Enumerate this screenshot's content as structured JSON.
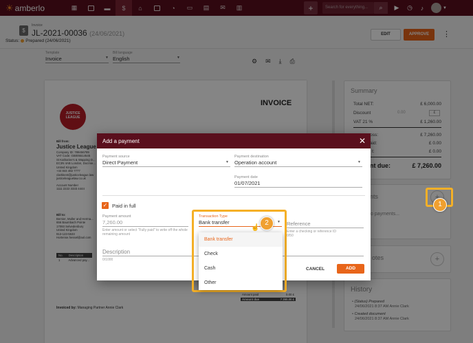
{
  "app": {
    "name": "amberlo"
  },
  "topbar": {
    "nav_icons": [
      "grid-icon",
      "contacts-icon",
      "briefcase-icon",
      "invoice-icon",
      "bank-icon",
      "calendar-icon",
      "phone-icon",
      "folder-icon",
      "documents-icon",
      "mail-icon",
      "reports-icon"
    ],
    "active_icon": "invoice-icon",
    "plus_label": "+",
    "search_placeholder": "Search for everything..."
  },
  "header": {
    "type_label": "Invoice",
    "number": "JL-2021-00036",
    "number_date": "(24/06/2021)",
    "status_prefix": "Status:",
    "status_text": "Prepared (24/06/2021)",
    "edit_label": "EDIT",
    "approve_label": "APPROVE"
  },
  "toolbar": {
    "template_label": "Template",
    "template_value": "Invoice",
    "language_label": "Bill language",
    "language_value": "English"
  },
  "paper": {
    "title": "INVOICE",
    "seal_text": "JUSTICE LEAGUE",
    "bill_from_label": "Bill from:",
    "company": "Justice League Law",
    "company_lines": [
      "Company ID: 789456789",
      "VAT Code: GB005514545",
      "St Katharine's & Wapping D...",
      "EC3N 4AB London, Docmie...",
      "United Kingdom",
      "+44 844 482 7777",
      "clarkkent@justiceleague.law",
      "justiceleaguelaw.co.uk"
    ],
    "account_label": "Account Number",
    "account_number": "1111 2222 3333 4444",
    "bill_to_label": "Bill to:",
    "bill_to_lines": [
      "Bernier, Muller and Herma...",
      "656 Baumbach Pointe",
      "17093 Selvedenbury",
      "United Kingdom",
      "913-123-5533",
      "Hortense.hessel@aol.com"
    ],
    "table_headers": [
      "No.",
      "Description"
    ],
    "table_row": [
      "1",
      "Advanced pay..."
    ],
    "amount_paid_label": "Amount paid",
    "amount_paid_value": "0.00 £",
    "amount_due_label": "Amount due",
    "amount_due_value": "7 260.00 £",
    "invoiced_by_label": "Invoiced by:",
    "invoiced_by_value": "Managing Partner Annie Clark"
  },
  "summary": {
    "title": "Summary",
    "total_net_label": "Total NET:",
    "total_net_value": "£ 6,000.00",
    "discount_label": "Discount",
    "discount_input": "0.00",
    "discount_currency": "£",
    "vat_label": "VAT 21 %",
    "vat_value": "£ 1,260.00",
    "gross_label": "ross:",
    "gross_value": "£ 7,260.00",
    "paid_label": "aid:",
    "paid_value": "£ 0.00",
    "credit_label": "t:",
    "credit_value": "£ 0.00",
    "due_label": "nt due:",
    "due_value": "£ 7,260.00"
  },
  "payments": {
    "title": "nts",
    "empty": "o payments..."
  },
  "notes": {
    "title": "otes"
  },
  "history": {
    "title": "History",
    "entries": [
      {
        "action": "(Status) Prepared",
        "meta": "24/06/2021 8:37 AM Annie Clark"
      },
      {
        "action": "Created document",
        "meta": "24/06/2021 8:37 AM Annie Clark"
      }
    ]
  },
  "modal": {
    "title": "Add a payment",
    "source_label": "Payment source",
    "source_value": "Direct Payment",
    "destination_label": "Payment destination",
    "destination_value": "Operation account",
    "date_label": "Payment date",
    "date_value": "01/07/2021",
    "paid_in_full_label": "Paid in full",
    "amount_label": "Payment amount",
    "amount_value": "7,260.00",
    "amount_help": "Enter amount or select \"Fully paid\" to write off the whole remaining amount",
    "transaction_label": "Transaction Type",
    "transaction_value": "Bank transfer",
    "reference_placeholder": "Reference",
    "reference_help": "Enter a checking or reference ID",
    "reference_count": "0/50",
    "description_label": "Description",
    "description_count": "0/1000",
    "cancel_label": "CANCEL",
    "add_label": "ADD",
    "dropdown_options": [
      "Bank transfer",
      "Check",
      "Cash",
      "Other"
    ],
    "dropdown_selected": "Bank transfer"
  },
  "callouts": {
    "badge_1": "1",
    "badge_2": "2"
  },
  "colors": {
    "brand": "#5a0f1d",
    "accent": "#e8651a",
    "highlight": "#f5b027"
  }
}
